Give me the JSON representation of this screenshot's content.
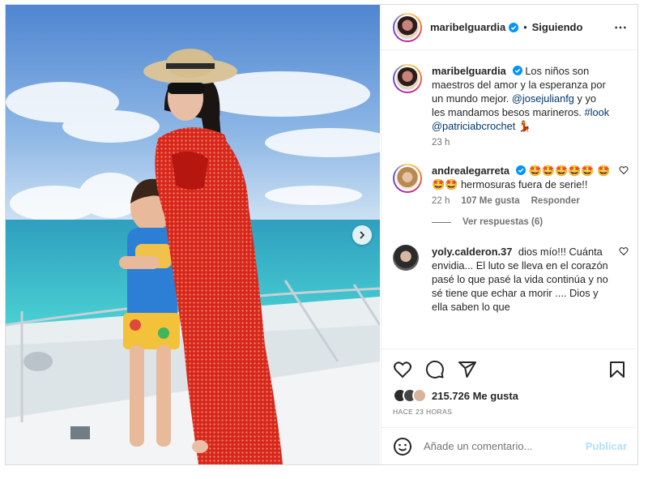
{
  "post": {
    "username": "maribelguardia",
    "separator": "•",
    "follow_status": "Siguiendo",
    "more_icon": "⋯"
  },
  "caption": {
    "username": "maribelguardia",
    "text_1": "Los niños son maestros del amor y la esperanza por un mundo mejor.",
    "mention_1": "@josejulianfg",
    "text_2": "y yo les mandamos besos marineros.",
    "hashtag": "#look",
    "mention_2": "@patriciabcrochet",
    "emoji": "💃",
    "time": "23 h"
  },
  "comments": [
    {
      "username": "andrealegarreta",
      "emojis_1": "🤩🤩🤩🤩🤩",
      "emojis_2": "🤩🤩🤩",
      "text": "hermosuras fuera de serie!!",
      "time": "22 h",
      "likes": "107 Me gusta",
      "reply": "Responder",
      "view_replies": "Ver respuestas (6)"
    },
    {
      "username": "yoly.calderon.37",
      "text": "dios mío!!! Cuánta envidia... El luto se lleva en el corazón pasé lo que pasé la vida continúa y no sé tiene que echar a morir .... Dios y ella saben lo que"
    }
  ],
  "likes": {
    "count": "215.726 Me gusta",
    "posted": "HACE 23 HORAS"
  },
  "add_comment": {
    "placeholder": "Añade un comentario...",
    "publish": "Publicar"
  },
  "colors": {
    "accent": "#0095f6",
    "link": "#00376b",
    "muted": "#737373",
    "dress": "#d42a1e",
    "sea": "#2fb8c9"
  },
  "icons": [
    "verified-badge-icon",
    "more-options-icon",
    "heart-icon",
    "comment-icon",
    "share-icon",
    "bookmark-icon",
    "emoji-icon",
    "next-arrow-icon"
  ]
}
